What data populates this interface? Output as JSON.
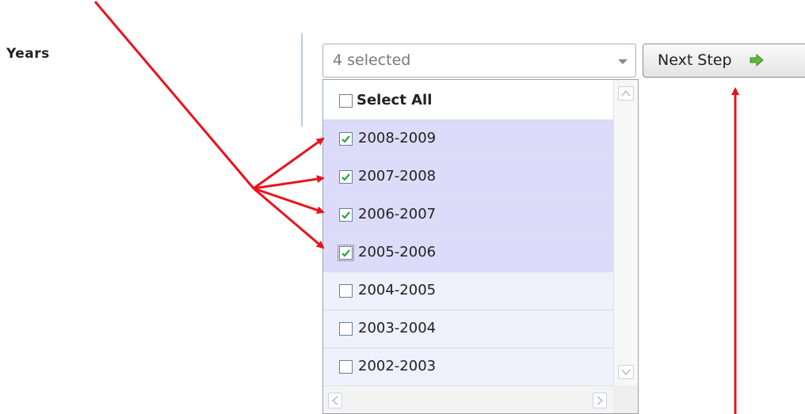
{
  "form": {
    "years_label": "Years"
  },
  "select": {
    "value_text": "4 selected",
    "select_all_label": "Select All",
    "options": [
      {
        "label": "2008-2009",
        "checked": true
      },
      {
        "label": "2007-2008",
        "checked": true
      },
      {
        "label": "2006-2007",
        "checked": true
      },
      {
        "label": "2005-2006",
        "checked": true
      },
      {
        "label": "2004-2005",
        "checked": false
      },
      {
        "label": "2003-2004",
        "checked": false
      },
      {
        "label": "2002-2003",
        "checked": false
      }
    ]
  },
  "buttons": {
    "next_step_label": "Next Step"
  },
  "icons": {
    "next_icon": "arrow-right-icon",
    "checkbox_check": "checkmark-icon"
  },
  "colors": {
    "selected_row": "#dcdcfa",
    "unselected_row": "#eef0fc",
    "checkmark": "#2ea043",
    "annotation_arrow": "#e8141c",
    "next_arrow_icon": "#5fb83a"
  }
}
